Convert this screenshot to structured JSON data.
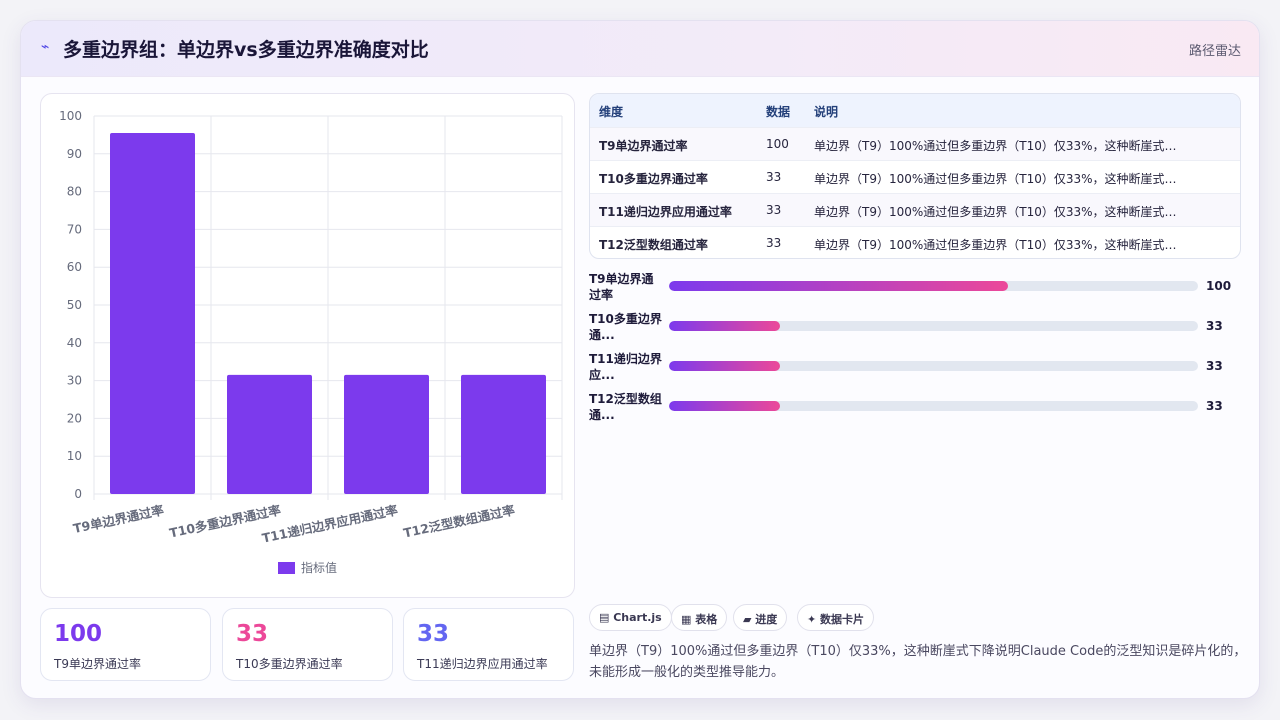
{
  "header": {
    "icon": "⌁",
    "title": "多重边界组：单边界vs多重边界准确度对比",
    "right_label": "路径雷达"
  },
  "chart_data": {
    "type": "bar",
    "categories": [
      "T9单边界通过率",
      "T10多重边界通过率",
      "T11递归边界应用通过率",
      "T12泛型数组通过率"
    ],
    "series": [
      {
        "name": "指标值",
        "values": [
          95.5,
          31.5,
          31.5,
          31.5
        ]
      }
    ],
    "ylim": [
      0,
      100
    ],
    "yticks": [
      0,
      10,
      20,
      30,
      40,
      50,
      60,
      70,
      80,
      90,
      100
    ],
    "grid": true,
    "legend": "bottom",
    "bar_color": "#7c3aed"
  },
  "kpis": [
    {
      "value": "100",
      "label": "T9单边界通过率",
      "color": "#7c3aed"
    },
    {
      "value": "33",
      "label": "T10多重边界通过率",
      "color": "#ec4899"
    },
    {
      "value": "33",
      "label": "T11递归边界应用通过率",
      "color": "#6366f1"
    }
  ],
  "table": {
    "headers": [
      "维度",
      "数据",
      "说明"
    ],
    "rows": [
      [
        "T9单边界通过率",
        "100",
        "单边界（T9）100%通过但多重边界（T10）仅33%，这种断崖式下..."
      ],
      [
        "T10多重边界通过率",
        "33",
        "单边界（T9）100%通过但多重边界（T10）仅33%，这种断崖式下..."
      ],
      [
        "T11递归边界应用通过率",
        "33",
        "单边界（T9）100%通过但多重边界（T10）仅33%，这种断崖式下..."
      ],
      [
        "T12泛型数组通过率",
        "33",
        "单边界（T9）100%通过但多重边界（T10）仅33%，这种断崖式下..."
      ]
    ]
  },
  "progress": [
    {
      "line1": "T9单边界通",
      "line2": "过率",
      "value": "100",
      "fraction": 0.64
    },
    {
      "line1": "T10多重边界",
      "line2": "通...",
      "value": "33",
      "fraction": 0.21
    },
    {
      "line1": "T11递归边界",
      "line2": "应...",
      "value": "33",
      "fraction": 0.21
    },
    {
      "line1": "T12泛型数组",
      "line2": "通...",
      "value": "33",
      "fraction": 0.21
    }
  ],
  "tags": [
    "▤ Chart.js",
    "▦ 表格",
    "▰ 进度",
    "✦ 数据卡片"
  ],
  "description": "单边界（T9）100%通过但多重边界（T10）仅33%，这种断崖式下降说明Claude Code的泛型知识是碎片化的，未能形成一般化的类型推导能力。"
}
